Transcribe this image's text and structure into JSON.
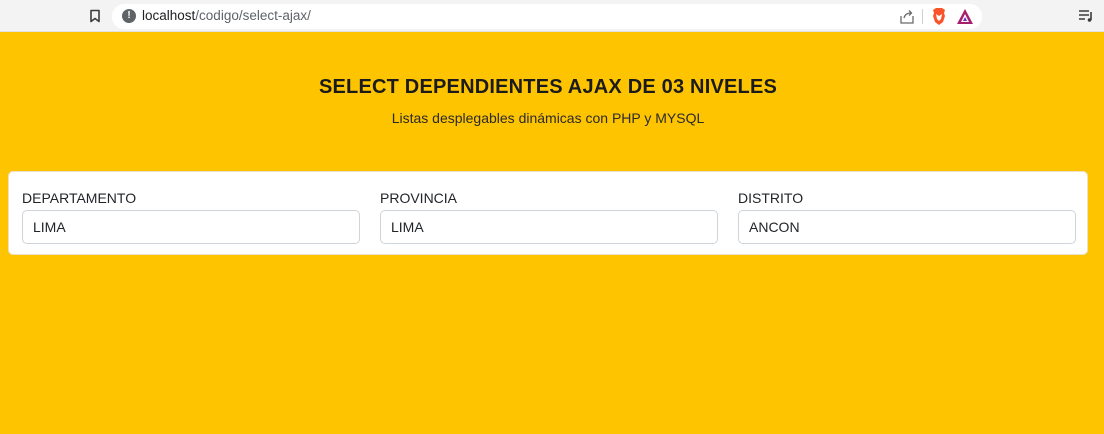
{
  "browser": {
    "url_host": "localhost",
    "url_path": "/codigo/select-ajax/",
    "icons": [
      "bookmark-icon",
      "site-info-icon",
      "share-icon",
      "brave-shields-icon",
      "brave-rewards-icon",
      "playlist-icon"
    ]
  },
  "page": {
    "title": "SELECT DEPENDIENTES AJAX DE 03 NIVELES",
    "subtitle": "Listas desplegables dinámicas con PHP y MYSQL",
    "background_color": "#ffc400"
  },
  "form": {
    "departamento": {
      "label": "DEPARTAMENTO",
      "value": "LIMA"
    },
    "provincia": {
      "label": "PROVINCIA",
      "value": "LIMA"
    },
    "distrito": {
      "label": "DISTRITO",
      "value": "ANCON"
    }
  }
}
